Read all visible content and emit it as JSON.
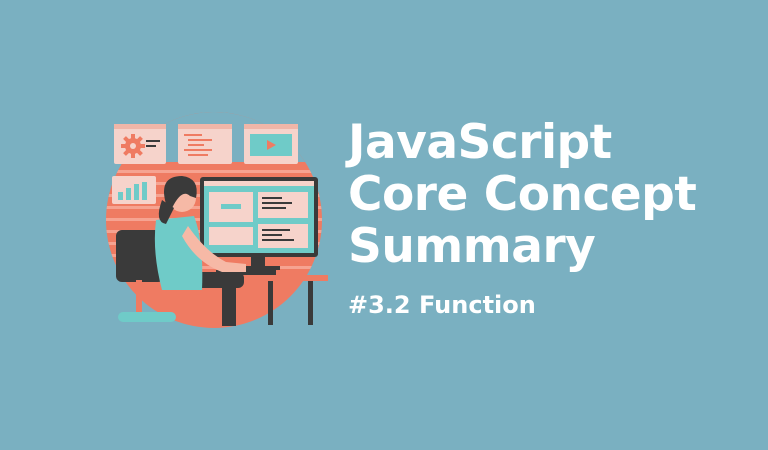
{
  "banner": {
    "title_lines": [
      "JavaScript",
      "Core Concept",
      "Summary"
    ],
    "subtitle": "#3.2 Function"
  },
  "colors": {
    "background": "#7ab0c1",
    "accent": "#ef7b62",
    "panel": "#f6d3cb",
    "teal": "#6fcbc8",
    "dark": "#3a3a3a",
    "text": "#ffffff"
  },
  "icons": [
    "gear-icon",
    "play-icon",
    "bar-chart-icon"
  ]
}
